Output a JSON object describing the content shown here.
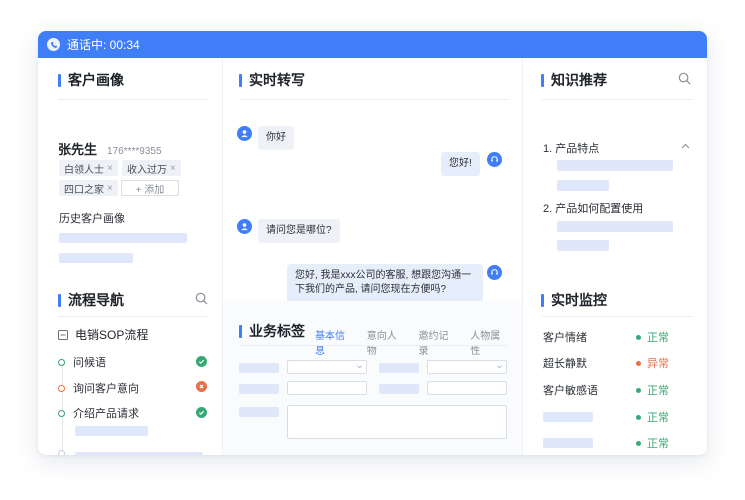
{
  "call_bar": {
    "status": "通话中: 00:34"
  },
  "profile": {
    "title": "客户画像",
    "name": "张先生",
    "phone": "176****9355",
    "tags": [
      "白领人士",
      "收入过万",
      "四口之家"
    ],
    "add_tag": "+ 添加",
    "history": "历史客户画像"
  },
  "flow": {
    "title": "流程导航",
    "sop": "电销SOP流程",
    "steps": [
      {
        "label": "问候语",
        "status": "done"
      },
      {
        "label": "询问客户意向",
        "status": "failed"
      },
      {
        "label": "介绍产品请求",
        "status": "done"
      }
    ]
  },
  "transcript": {
    "title": "实时转写",
    "messages": [
      {
        "side": "left",
        "text": "你好"
      },
      {
        "side": "right",
        "text": "您好!"
      },
      {
        "side": "left",
        "text": "请问您是哪位?"
      },
      {
        "side": "right",
        "text": "您好, 我是xxx公司的客服, 想跟您沟通一下我们的产品, 请问您现在方便吗?"
      }
    ]
  },
  "business": {
    "title": "业务标签",
    "tabs": [
      "基本信息",
      "意向人物",
      "邀约记录",
      "人物属性"
    ],
    "active_tab": 0
  },
  "knowledge": {
    "title": "知识推荐",
    "items": [
      "1. 产品特点",
      "2. 产品如何配置使用"
    ]
  },
  "monitor": {
    "title": "实时监控",
    "rows": [
      {
        "label": "客户情绪",
        "status": "正常",
        "level": "normal"
      },
      {
        "label": "超长静默",
        "status": "异常",
        "level": "abnormal"
      },
      {
        "label": "客户敏感语",
        "status": "正常",
        "level": "normal"
      },
      {
        "label": "",
        "status": "正常",
        "level": "normal"
      },
      {
        "label": "",
        "status": "正常",
        "level": "normal"
      }
    ]
  },
  "colors": {
    "accent": "#3f7ef6",
    "ok": "#3aa876",
    "warn": "#e8704a",
    "placeholder": "#dfe8fb"
  },
  "icons": [
    "phone-icon",
    "search-icon",
    "collapse-icon",
    "chevron-up-icon",
    "user-icon",
    "headset-icon",
    "check-icon",
    "close-icon"
  ]
}
